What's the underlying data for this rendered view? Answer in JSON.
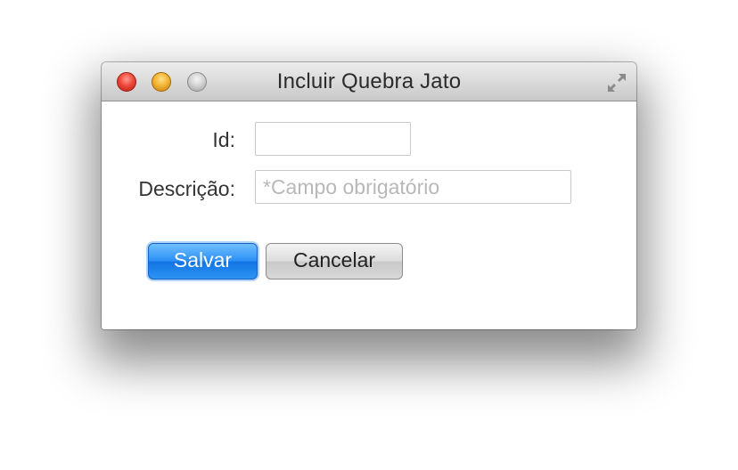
{
  "window": {
    "title": "Incluir Quebra Jato"
  },
  "form": {
    "id_label": "Id:",
    "id_value": "",
    "description_label": "Descrição:",
    "description_value": "",
    "description_placeholder": "*Campo obrigatório"
  },
  "buttons": {
    "save_label": "Salvar",
    "cancel_label": "Cancelar"
  },
  "icons": {
    "close": "close-icon",
    "minimize": "minimize-icon",
    "zoom": "zoom-icon",
    "fullscreen": "fullscreen-icon"
  },
  "colors": {
    "close": "#ee4a3d",
    "minimize": "#f3b636",
    "zoom": "#cfcfcf",
    "primary_button": "#2b8ef5"
  }
}
